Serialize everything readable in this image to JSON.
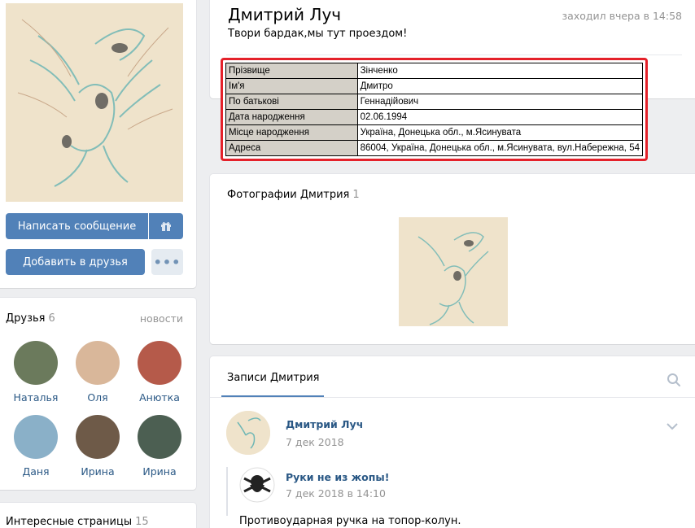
{
  "profile": {
    "name": "Дмитрий Луч",
    "status": "Твори бардак,мы тут проездом!",
    "online": "заходил вчера в 14:58"
  },
  "actions": {
    "message_label": "Написать сообщение",
    "add_friend_label": "Добавить в друзья",
    "more_label": "•••"
  },
  "info_table": [
    {
      "label": "Прізвище",
      "value": "Зінченко"
    },
    {
      "label": "Ім'я",
      "value": "Дмитро"
    },
    {
      "label": "По батькові",
      "value": "Геннадійович"
    },
    {
      "label": "Дата народження",
      "value": "02.06.1994"
    },
    {
      "label": "Місце народження",
      "value": "Україна, Донецька обл., м.Ясинувата"
    },
    {
      "label": "Адреса",
      "value": "86004, Україна, Донецька обл., м.Ясинувата, вул.Набережна, 54"
    }
  ],
  "friends": {
    "title": "Друзья",
    "count": "6",
    "news_link": "новости",
    "items": [
      {
        "name": "Наталья",
        "color": "#6b7a5c"
      },
      {
        "name": "Оля",
        "color": "#d9b79a"
      },
      {
        "name": "Анютка",
        "color": "#b55a4a"
      },
      {
        "name": "Даня",
        "color": "#8ab0c8"
      },
      {
        "name": "Ирина",
        "color": "#6e5a48"
      },
      {
        "name": "Ирина",
        "color": "#4c5f52"
      }
    ]
  },
  "interesting": {
    "title": "Интересные страницы",
    "count": "15"
  },
  "photos": {
    "title": "Фотографии Дмитрия",
    "count": "1"
  },
  "wall": {
    "tab": "Записи Дмитрия",
    "post": {
      "author": "Дмитрий Луч",
      "date": "7 дек 2018",
      "repost_author": "Руки не из жопы!",
      "repost_date": "7 дек 2018 в 14:10",
      "text": "Противоударная ручка на топор-колун."
    }
  },
  "colors": {
    "accent": "#5181b8",
    "link": "#2a5885",
    "highlight": "#e4212a"
  }
}
